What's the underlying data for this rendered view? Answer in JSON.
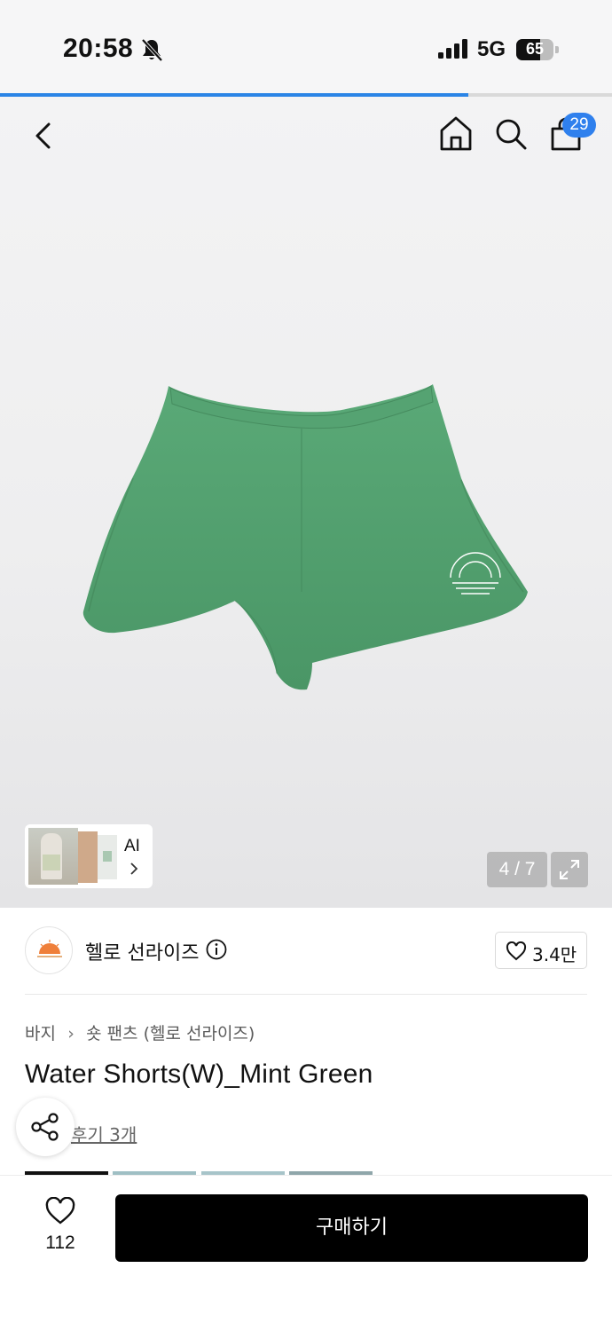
{
  "status_bar": {
    "time": "20:58",
    "network": "5G",
    "battery": "65",
    "battery_level": 0.65
  },
  "loading_progress": 0.765,
  "nav": {
    "cart_count": "29",
    "icons": [
      "back-icon",
      "home-icon",
      "search-icon",
      "shopping-bag-icon"
    ]
  },
  "gallery": {
    "ai_label": "AI",
    "counter": "4 / 7",
    "product_color": "#4f9f6e",
    "print_color": "#ffffff"
  },
  "brand": {
    "name": "헬로 선라이즈",
    "like_count": "3.4만"
  },
  "product": {
    "breadcrumb": [
      "바지",
      "숏 팬츠 (헬로 선라이즈)"
    ],
    "title": "Water Shorts(W)_Mint Green",
    "review_link": "후기 3개"
  },
  "bottom_bar": {
    "wishlist_count": "112",
    "buy_label": "구매하기"
  },
  "colors": {
    "accent_blue": "#2f80ed",
    "progress_blue": "#2a84e6",
    "buy_button": "#000000"
  }
}
